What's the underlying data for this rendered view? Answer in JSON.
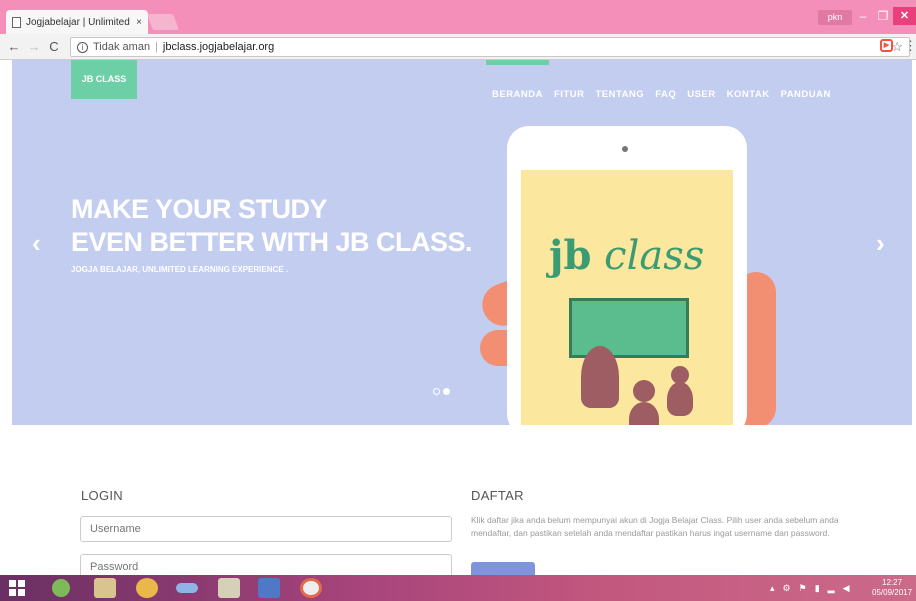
{
  "browser": {
    "tab_title": "Jogjabelajar | Unlimited",
    "tab_close": "×",
    "user_chip": "pkn",
    "security_label": "Tidak aman",
    "url": "jbclass.jogjabelajar.org",
    "star_icon": "star-icon",
    "menu_icon": "more-vert-icon"
  },
  "site": {
    "logo": "JB CLASS",
    "nav": [
      "BERANDA",
      "FITUR",
      "TENTANG",
      "FAQ",
      "USER",
      "KONTAK",
      "PANDUAN"
    ],
    "headline_line1": "MAKE YOUR STUDY",
    "headline_line2": "EVEN BETTER WITH JB CLASS.",
    "subline": "JOGJA BELAJAR, UNLIMITED LEARNING EXPERIENCE .",
    "brand_jb": "jb",
    "brand_class": "class",
    "arrow_left": "‹",
    "arrow_right": "›"
  },
  "login": {
    "title": "LOGIN",
    "username_placeholder": "Username",
    "password_placeholder": "Password"
  },
  "daftar": {
    "title": "DAFTAR",
    "text": "Klik daftar jika anda belum mempunyai akun di Jogja Belajar Class. Pilih user anda sebelum anda mendaftar, dan pastikan setelah anda mendaftar pastikan harus ingat username dan password."
  },
  "taskbar": {
    "time": "12:27",
    "date": "05/09/2017"
  },
  "colors": {
    "accent": "#6ccfa6",
    "hero_bg": "#c3cdf0",
    "titlebar": "#f48fb9"
  }
}
